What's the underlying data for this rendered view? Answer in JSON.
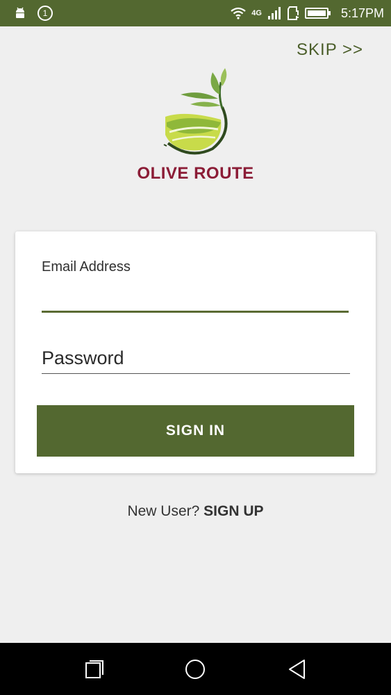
{
  "status_bar": {
    "notification_count": "1",
    "network_type": "4G",
    "time": "5:17PM",
    "icons": [
      "android-icon",
      "notification-count-icon",
      "wifi-icon",
      "signal-icon",
      "sim-alert-icon",
      "battery-icon"
    ]
  },
  "header": {
    "skip_label": "SKIP >>"
  },
  "brand": {
    "name": "OLIVE ROUTE",
    "colors": {
      "primary": "#536830",
      "brand_text": "#8b1c36",
      "leaf_light": "#c8db4a",
      "leaf_dark": "#5d8a2e"
    }
  },
  "login_form": {
    "email_label": "Email Address",
    "email_value": "",
    "password_placeholder": "Password",
    "password_value": "",
    "sign_in_label": "SIGN IN"
  },
  "signup": {
    "prompt": "New User?",
    "link_label": "SIGN UP"
  },
  "nav_bar": {
    "icons": [
      "recent-apps-icon",
      "home-icon",
      "back-icon"
    ]
  }
}
